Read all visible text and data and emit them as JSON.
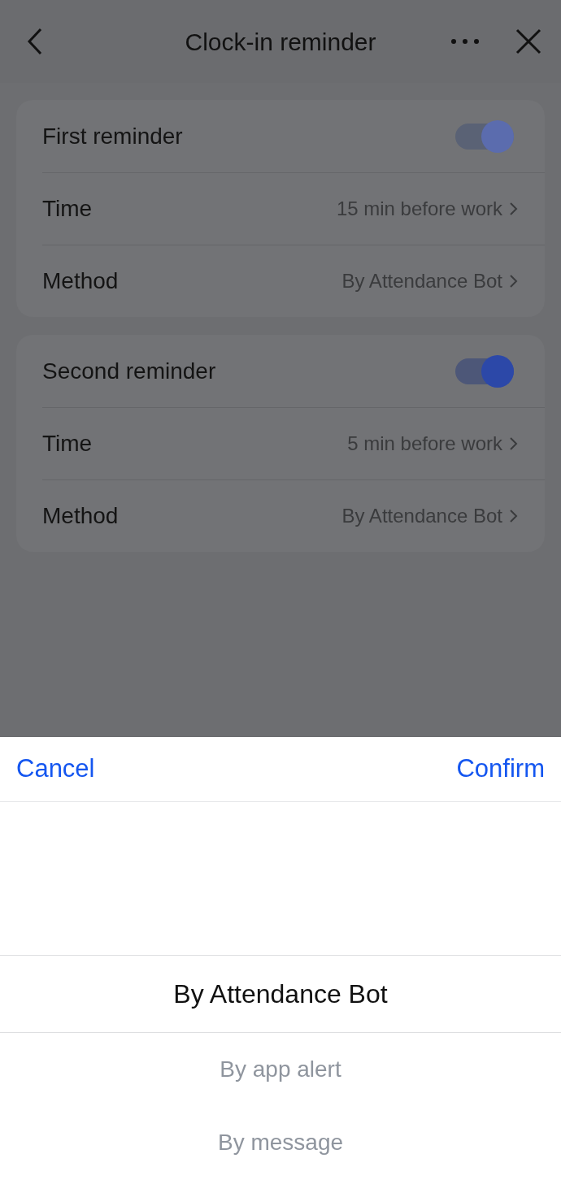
{
  "header": {
    "title": "Clock-in reminder"
  },
  "sections": [
    {
      "rows": [
        {
          "kind": "toggle",
          "label": "First reminder",
          "on": true,
          "disabled": true
        },
        {
          "kind": "value",
          "label": "Time",
          "value": "15 min before work"
        },
        {
          "kind": "value",
          "label": "Method",
          "value": "By Attendance Bot"
        }
      ]
    },
    {
      "rows": [
        {
          "kind": "toggle",
          "label": "Second reminder",
          "on": true,
          "disabled": false
        },
        {
          "kind": "value",
          "label": "Time",
          "value": "5 min before work"
        },
        {
          "kind": "value",
          "label": "Method",
          "value": "By Attendance Bot"
        }
      ]
    }
  ],
  "sheet": {
    "cancel": "Cancel",
    "confirm": "Confirm",
    "options": [
      {
        "label": "By Attendance Bot",
        "selected": true
      },
      {
        "label": "By app alert",
        "selected": false
      },
      {
        "label": "By message",
        "selected": false
      }
    ]
  }
}
